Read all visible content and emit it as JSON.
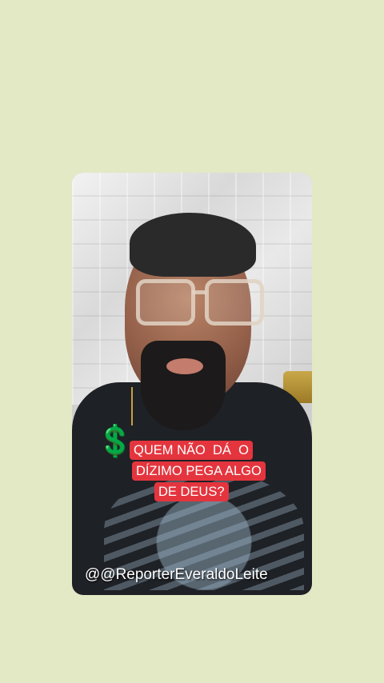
{
  "video": {
    "caption_lines": [
      "QUEM NÃO  DÁ  O",
      "DÍZIMO PEGA ALGO",
      "DE DEUS?"
    ],
    "emoji_icon": "💲",
    "handle": "@@ReporterEveraldoLeite"
  },
  "colors": {
    "background": "#e3e8c5",
    "caption_bg": "#e4353e",
    "caption_text": "#ffffff",
    "emoji": "#2bb35a"
  }
}
